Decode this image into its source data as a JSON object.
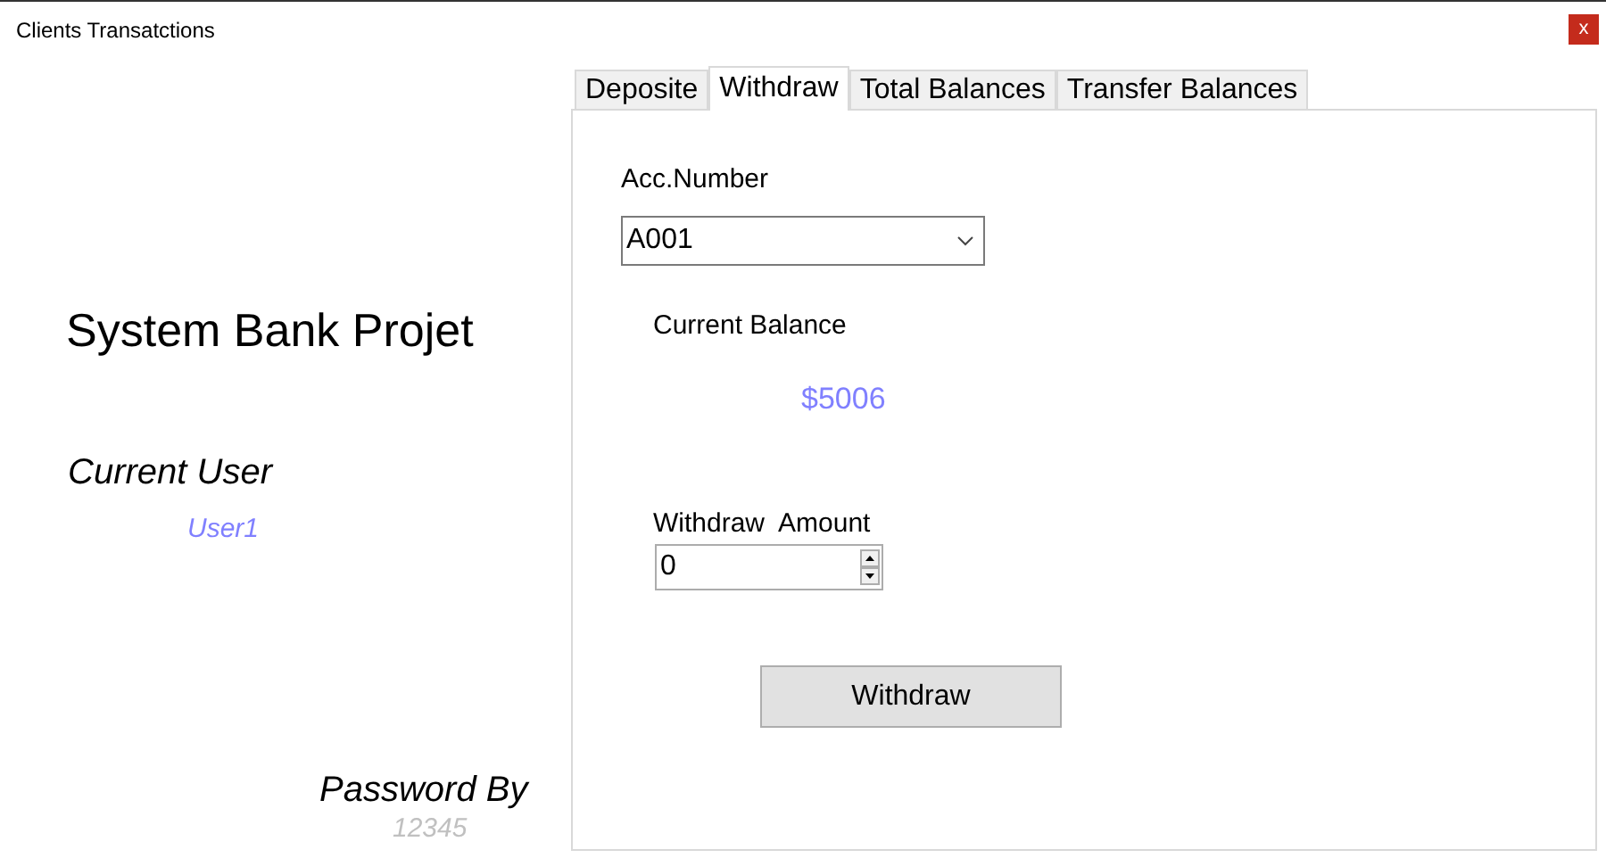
{
  "window": {
    "title": "Clients Transatctions",
    "close": "x"
  },
  "sidebar": {
    "app_title": "System Bank Projet",
    "user_label": "Current User",
    "user_value": "User1",
    "password_label": "Password By",
    "password_value": "12345"
  },
  "tabs": [
    {
      "label": "Deposite",
      "selected": false
    },
    {
      "label": "Withdraw",
      "selected": true
    },
    {
      "label": "Total Balances",
      "selected": false
    },
    {
      "label": "Transfer Balances",
      "selected": false
    }
  ],
  "form": {
    "account_label": "Acc.Number",
    "account_value": "A001",
    "balance_label": "Current Balance",
    "balance_value": "$5006",
    "amount_label": "Withdraw  Amount",
    "amount_value": "0",
    "submit": "Withdraw"
  }
}
